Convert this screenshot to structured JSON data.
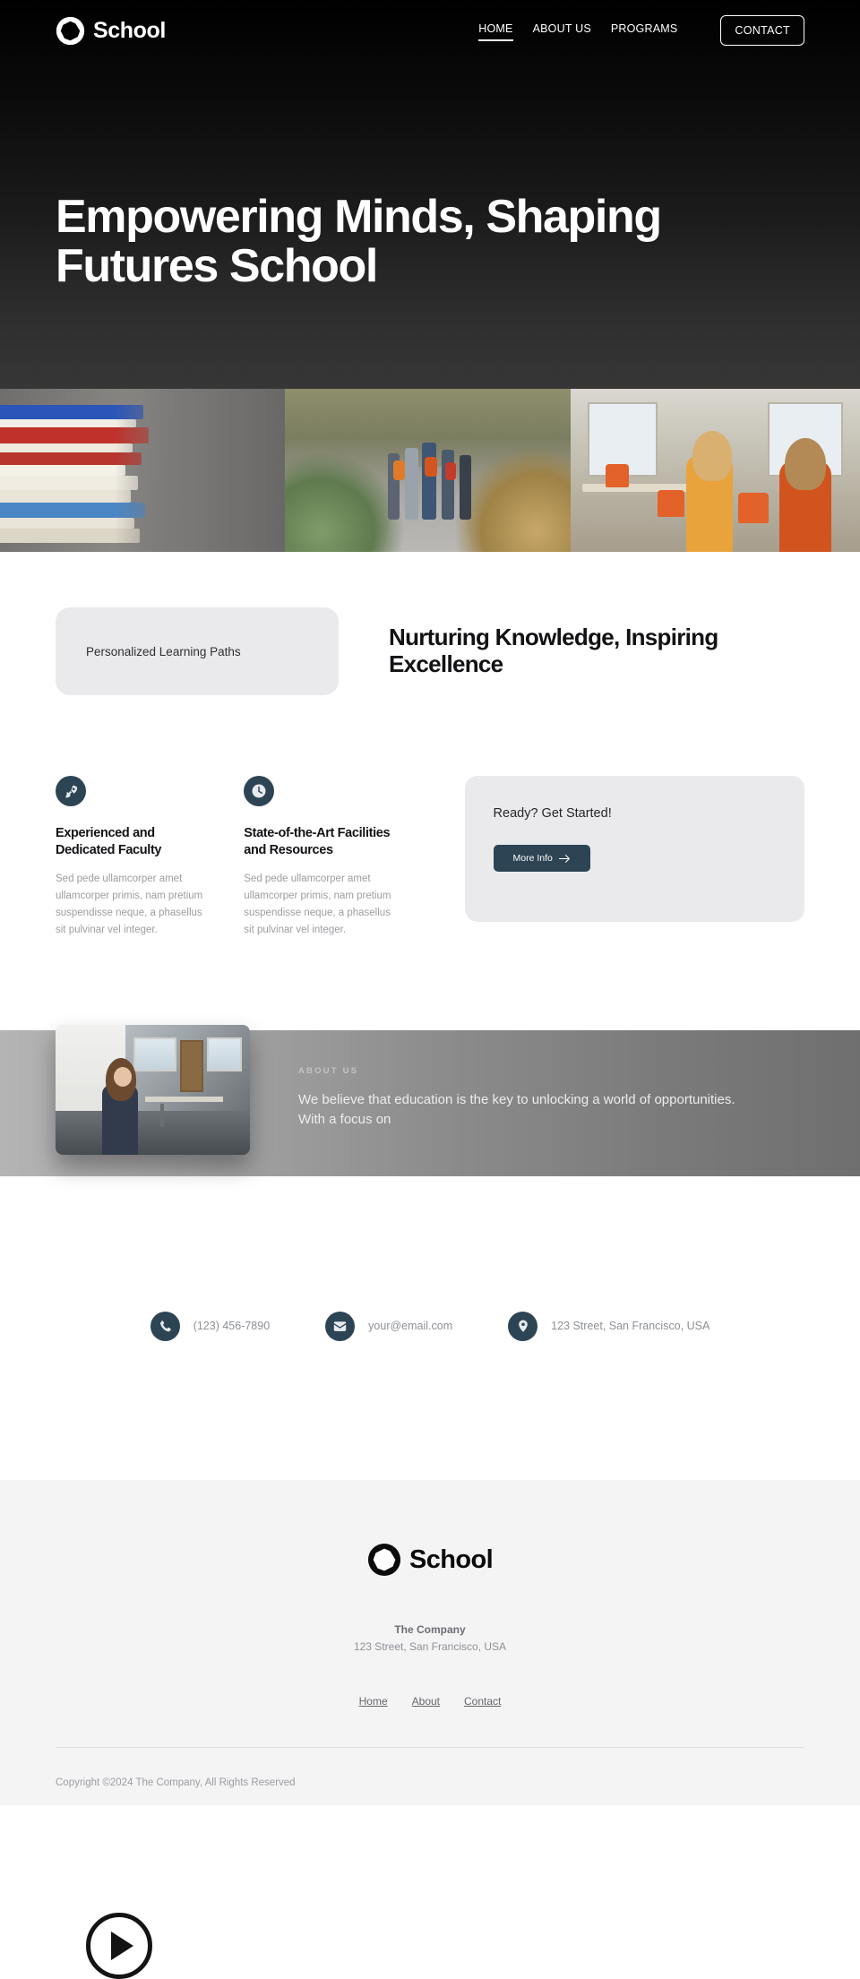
{
  "brand": {
    "name": "School",
    "logo_icon": "octagon-circle-logo"
  },
  "nav": {
    "items": [
      {
        "label": "HOME",
        "active": true
      },
      {
        "label": "ABOUT US",
        "active": false
      },
      {
        "label": "PROGRAMS",
        "active": false
      }
    ],
    "cta_label": "CONTACT"
  },
  "hero": {
    "title": "Empowering Minds, Shaping Futures School"
  },
  "strip": {
    "images": [
      {
        "alt": "stack-of-books"
      },
      {
        "alt": "students-walking-with-backpacks"
      },
      {
        "alt": "students-in-classroom"
      }
    ]
  },
  "intro": {
    "pill_label": "Personalized Learning Paths",
    "heading": "Nurturing Knowledge, Inspiring Excellence"
  },
  "features": [
    {
      "icon": "rocket-icon",
      "title": "Experienced and Dedicated Faculty",
      "body": "Sed pede ullamcorper amet ullamcorper primis, nam pretium suspendisse neque, a phasellus sit pulvinar vel integer."
    },
    {
      "icon": "clock-icon",
      "title": "State-of-the-Art Facilities and Resources",
      "body": "Sed pede ullamcorper amet ullamcorper primis, nam pretium suspendisse neque, a phasellus sit pulvinar vel integer."
    }
  ],
  "cta": {
    "title": "Ready? Get Started!",
    "button_label": "More Info",
    "button_icon": "arrow-right-icon"
  },
  "about": {
    "eyebrow": "ABOUT US",
    "copy": "We believe that education is the key to unlocking a world of opportunities. With a focus on",
    "video_icon": "play-icon",
    "video_alt": "teacher-standing-in-classroom"
  },
  "contacts": [
    {
      "icon": "phone-icon",
      "text": "(123) 456-7890"
    },
    {
      "icon": "envelope-icon",
      "text": "your@email.com"
    },
    {
      "icon": "map-pin-icon",
      "text": "123 Street, San Francisco, USA"
    }
  ],
  "footer": {
    "brand_name": "School",
    "company": "The Company",
    "address": "123 Street, San Francisco, USA",
    "links": [
      {
        "label": "Home"
      },
      {
        "label": "About"
      },
      {
        "label": "Contact"
      }
    ],
    "copyright": "Copyright ©2024 The Company, All Rights Reserved"
  },
  "colors": {
    "accent": "#2d4455",
    "hero_bg": "#000000",
    "card_bg": "#eaeaec",
    "footer_bg": "#f4f4f5"
  }
}
